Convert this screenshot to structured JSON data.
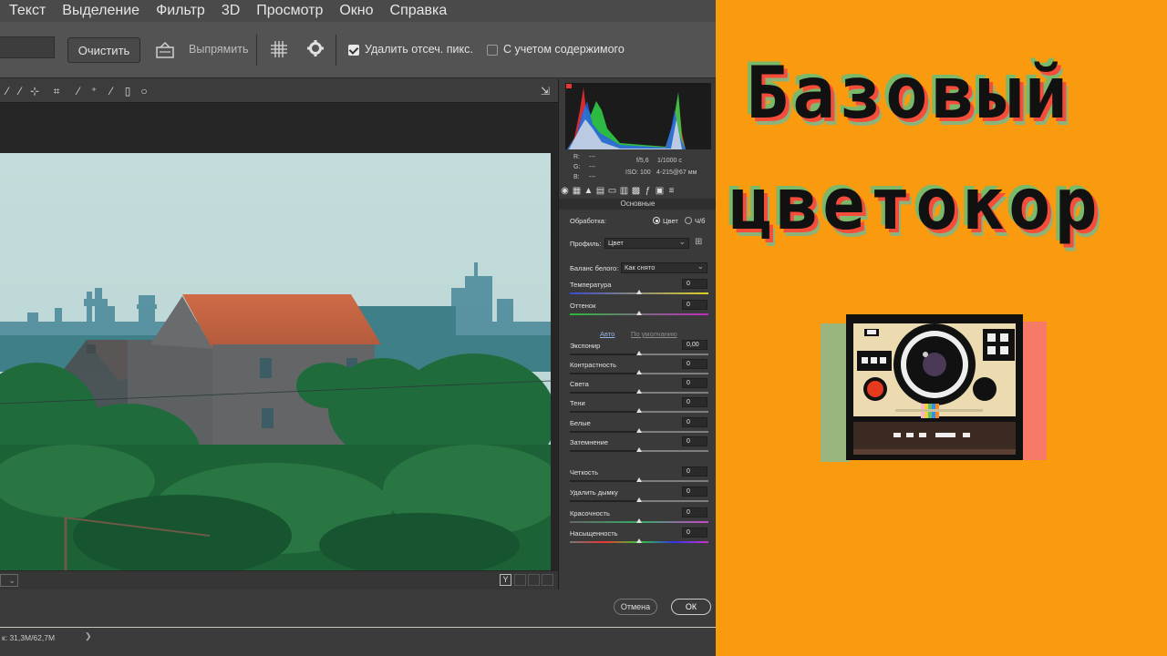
{
  "menu": [
    "Текст",
    "Выделение",
    "Фильтр",
    "3D",
    "Просмотр",
    "Окно",
    "Справка"
  ],
  "options": {
    "clear_label": "Очистить",
    "straighten_label": "Выпрямить",
    "delete_cropped_label": "Удалить отсеч. пикс.",
    "delete_cropped_checked": true,
    "content_aware_label": "С учетом содержимого",
    "content_aware_checked": false
  },
  "camera_raw": {
    "info": {
      "r": "R:",
      "g": "G:",
      "b": "B:",
      "r_val": "---",
      "g_val": "---",
      "b_val": "---",
      "aperture": "f/5,6",
      "shutter": "1/1000 с",
      "iso": "ISO: 100",
      "lens": "4-215@67 мм"
    },
    "panel_title": "Основные",
    "processing_label": "Обработка:",
    "processing_color": "Цвет",
    "processing_bw": "Ч/б",
    "profile_label": "Профиль:",
    "profile_value": "Цвет",
    "wb_label": "Баланс белого:",
    "wb_value": "Как снято",
    "auto_label": "Авто",
    "default_label": "По умолчанию",
    "sliders": [
      {
        "label": "Температура",
        "value": "0"
      },
      {
        "label": "Оттенок",
        "value": "0"
      },
      {
        "label": "Экспонир",
        "value": "0,00"
      },
      {
        "label": "Контрастность",
        "value": "0"
      },
      {
        "label": "Света",
        "value": "0"
      },
      {
        "label": "Тени",
        "value": "0"
      },
      {
        "label": "Белые",
        "value": "0"
      },
      {
        "label": "Затемнение",
        "value": "0"
      },
      {
        "label": "Четкость",
        "value": "0"
      },
      {
        "label": "Удалить дымку",
        "value": "0"
      },
      {
        "label": "Красочность",
        "value": "0"
      },
      {
        "label": "Насыщенность",
        "value": "0"
      }
    ],
    "y_label": "Y",
    "cancel_label": "Отмена",
    "ok_label": "ОК"
  },
  "status_text": "к: 31,3M/62,7M",
  "status_arrow": "❯",
  "title_line1": "Базовый",
  "title_line2": "цветокор",
  "colors": {
    "background": "#f99a0f",
    "accent_red": "#f64c3a",
    "accent_green": "#7ab86a"
  }
}
